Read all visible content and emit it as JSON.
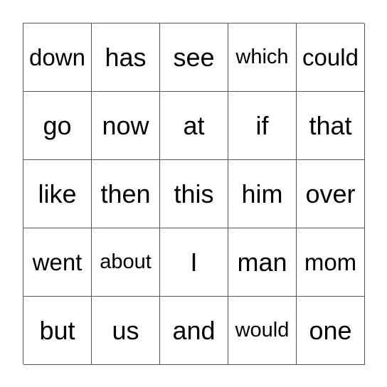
{
  "card": {
    "rows": [
      [
        "down",
        "has",
        "see",
        "which",
        "could"
      ],
      [
        "go",
        "now",
        "at",
        "if",
        "that"
      ],
      [
        "like",
        "then",
        "this",
        "him",
        "over"
      ],
      [
        "went",
        "about",
        "I",
        "man",
        "mom"
      ],
      [
        "but",
        "us",
        "and",
        "would",
        "one"
      ]
    ]
  }
}
